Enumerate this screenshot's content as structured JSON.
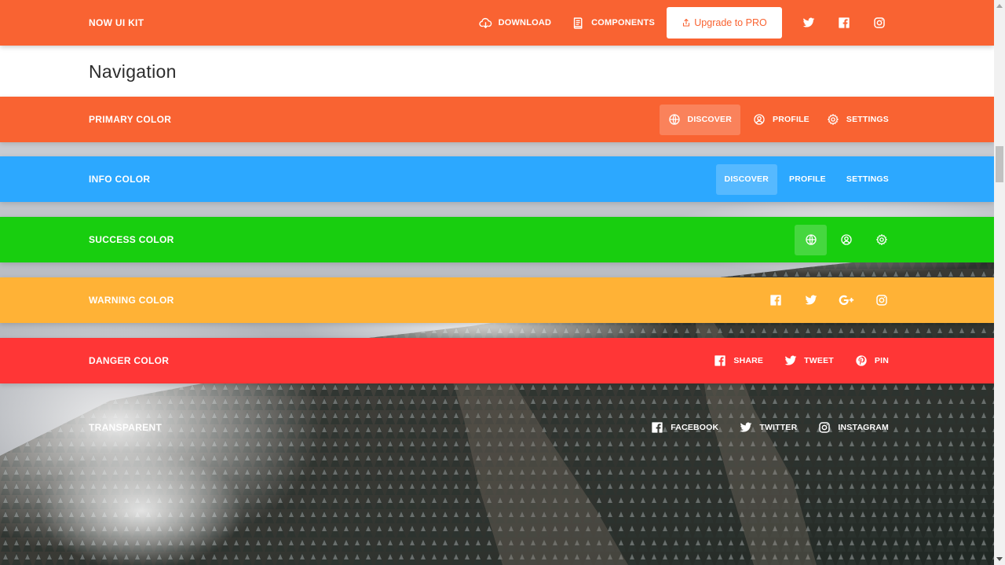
{
  "colors": {
    "primary": "#f96332",
    "info": "#2ca8ff",
    "success": "#18ce0f",
    "warning": "#ffb236",
    "danger": "#ff3636"
  },
  "topbar": {
    "brand": "NOW UI KIT",
    "links": [
      {
        "label": "DOWNLOAD",
        "icon": "cloud-download-icon"
      },
      {
        "label": "COMPONENTS",
        "icon": "book-icon"
      }
    ],
    "upgrade_label": "Upgrade to PRO",
    "social": [
      "twitter-icon",
      "facebook-icon",
      "instagram-icon"
    ]
  },
  "page": {
    "title": "Navigation"
  },
  "bars": {
    "primary": {
      "brand": "PRIMARY COLOR",
      "links": [
        {
          "label": "DISCOVER",
          "icon": "globe-icon",
          "active": true
        },
        {
          "label": "PROFILE",
          "icon": "user-circle-icon"
        },
        {
          "label": "SETTINGS",
          "icon": "gear-icon"
        }
      ]
    },
    "info": {
      "brand": "INFO COLOR",
      "links": [
        {
          "label": "DISCOVER",
          "active": true
        },
        {
          "label": "PROFILE"
        },
        {
          "label": "SETTINGS"
        }
      ]
    },
    "success": {
      "brand": "SUCCESS COLOR",
      "icons": [
        "globe-icon",
        "user-circle-icon",
        "gear-icon"
      ]
    },
    "warning": {
      "brand": "WARNING COLOR",
      "icons": [
        "facebook-icon",
        "twitter-icon",
        "google-plus-icon",
        "instagram-icon"
      ]
    },
    "danger": {
      "brand": "DANGER COLOR",
      "links": [
        {
          "label": "SHARE",
          "icon": "facebook-icon"
        },
        {
          "label": "TWEET",
          "icon": "twitter-icon"
        },
        {
          "label": "PIN",
          "icon": "pinterest-icon"
        }
      ]
    },
    "transparent": {
      "brand": "TRANSPARENT",
      "links": [
        {
          "label": "FACEBOOK",
          "icon": "facebook-icon"
        },
        {
          "label": "TWITTER",
          "icon": "twitter-icon"
        },
        {
          "label": "INSTAGRAM",
          "icon": "instagram-icon"
        }
      ]
    }
  }
}
